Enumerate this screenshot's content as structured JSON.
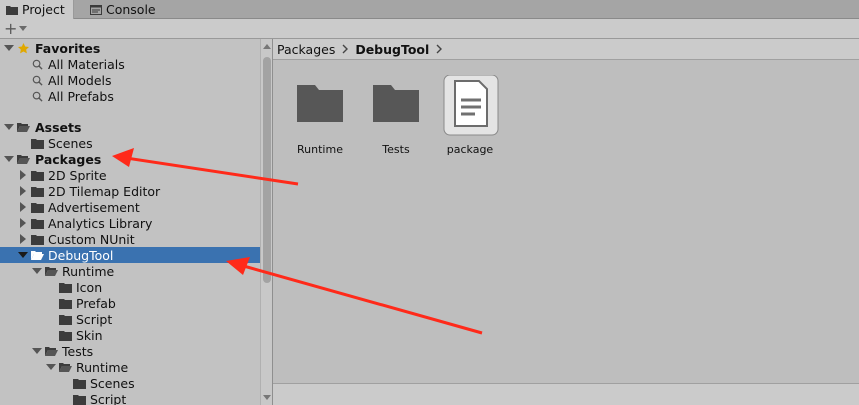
{
  "tabs": [
    {
      "label": "Project",
      "icon": "folder-icon",
      "active": true
    },
    {
      "label": "Console",
      "icon": "console-icon",
      "active": false
    }
  ],
  "toolbar": {
    "add_symbol": "+"
  },
  "tree": {
    "favorites": {
      "label": "Favorites",
      "items": [
        "All Materials",
        "All Models",
        "All Prefabs"
      ]
    },
    "assets": {
      "label": "Assets",
      "items": [
        "Scenes"
      ]
    },
    "packages": {
      "label": "Packages",
      "items": [
        "2D Sprite",
        "2D Tilemap Editor",
        "Advertisement",
        "Analytics Library",
        "Custom NUnit",
        "DebugTool"
      ],
      "debugtool_children": {
        "runtime": "Runtime",
        "runtime_children": [
          "Icon",
          "Prefab",
          "Script",
          "Skin"
        ],
        "tests": "Tests",
        "tests_runtime": "Runtime",
        "tests_runtime_children": [
          "Scenes",
          "Script"
        ]
      }
    }
  },
  "breadcrumb": [
    "Packages",
    "DebugTool"
  ],
  "assets_grid": [
    {
      "label": "Runtime",
      "icon": "folder-icon"
    },
    {
      "label": "Tests",
      "icon": "folder-icon"
    },
    {
      "label": "package",
      "icon": "document-icon"
    }
  ],
  "colors": {
    "selection": "#3a72b0",
    "annotation_arrow": "#ff2a1a",
    "star": "#e0a800"
  }
}
